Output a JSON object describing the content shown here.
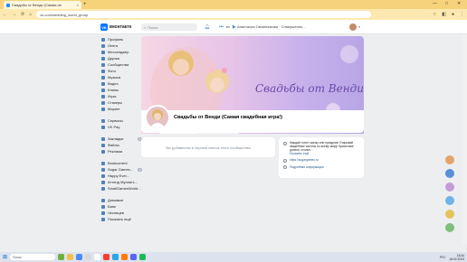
{
  "browser": {
    "tab_title": "Свадьбы от Венди (Самая св",
    "tab_close": "×",
    "newtab": "+",
    "url": "vk.com/wedding_world_group",
    "win_min": "—",
    "win_max": "□",
    "win_close": "✕",
    "nav": {
      "back": "←",
      "forward": "→",
      "reload": "⟳",
      "home": "⌂"
    }
  },
  "vk": {
    "logo_text": "вконтакте",
    "logo_letters": "VK",
    "search_placeholder": "Поиск",
    "player_text": "Анастасия Овчинникова · Совершенно...",
    "nav_items": [
      {
        "label": "Профиль"
      },
      {
        "label": "Лента"
      },
      {
        "label": "Мессенджер"
      },
      {
        "label": "Друзья"
      },
      {
        "label": "Сообщества"
      },
      {
        "label": "Фото"
      },
      {
        "label": "Музыка"
      },
      {
        "label": "Видео"
      },
      {
        "label": "Клипы"
      },
      {
        "label": "Игры"
      },
      {
        "label": "Стикеры"
      },
      {
        "label": "Маркет"
      }
    ],
    "nav_items2": [
      {
        "label": "Сервисы"
      },
      {
        "label": "VK Pay"
      }
    ],
    "nav_items3": [
      {
        "label": "Закладки",
        "badge": "1"
      },
      {
        "label": "Файлы"
      },
      {
        "label": "Реклама"
      }
    ],
    "nav_items4": [
      {
        "label": "Bookcurrent"
      },
      {
        "label": "Sugar Games...",
        "badge": "1"
      },
      {
        "label": "Happy Ever..."
      },
      {
        "label": "Аттенд Муллигз..."
      },
      {
        "label": "SmallGamesWorld..."
      }
    ],
    "nav_items5": [
      {
        "label": "Домовые"
      },
      {
        "label": "Банк"
      },
      {
        "label": "Чесницев"
      },
      {
        "label": "Показать ещё"
      }
    ]
  },
  "group": {
    "title": "Свадьбы от Венди (Самая свадебная игра!)",
    "cover_logo": "Свадьбы от Венди",
    "blocked_text": "Вы добавлены в чёрный список этого сообщества",
    "info": {
      "description": "Каждый хочет сказку или праздник! Открывай свадебные салоны по всему миру! Красочные уровни, стильн...",
      "more": "Показать ещё",
      "link": "https://sugargames.ru",
      "details": "Подробная информация"
    }
  },
  "taskbar": {
    "search": "Поиск",
    "lang": "РУС",
    "time": "16:34",
    "date": "18.02.2023"
  },
  "colors": {
    "vk_blue": "#0077ff",
    "chrome_tab_bg": "#f6d37a",
    "page_bg": "#edeef0"
  }
}
